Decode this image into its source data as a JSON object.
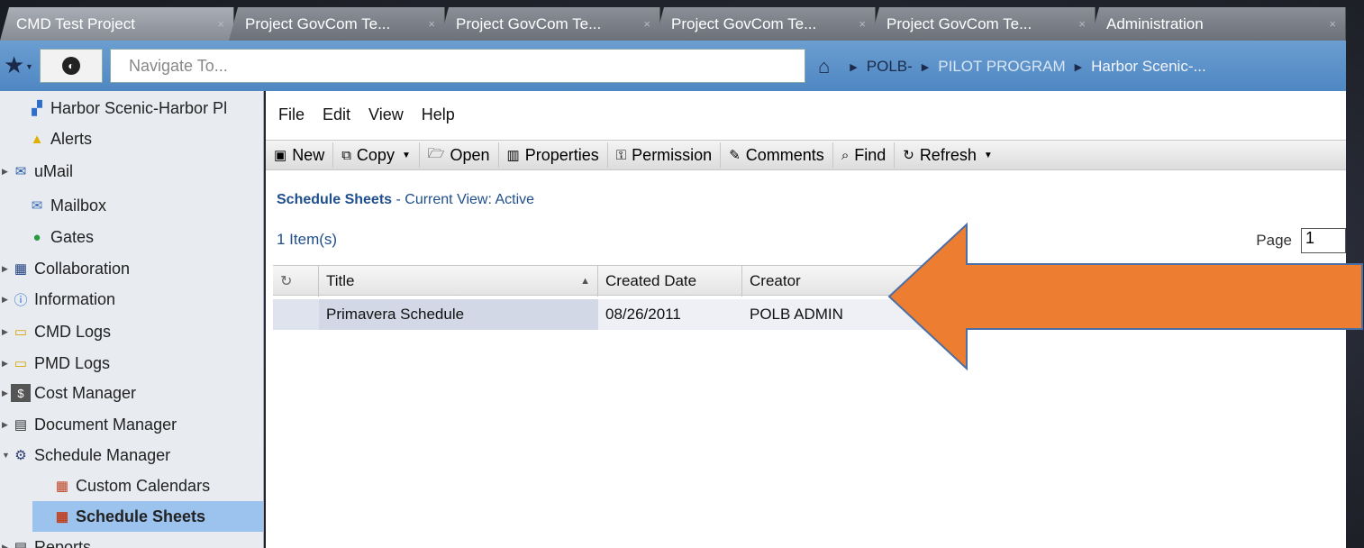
{
  "tabs": [
    {
      "label": "CMD Test Project",
      "close": "×"
    },
    {
      "label": "Project GovCom Te...",
      "close": "×"
    },
    {
      "label": "Project GovCom Te...",
      "close": "×"
    },
    {
      "label": "Project GovCom Te...",
      "close": "×"
    },
    {
      "label": "Project GovCom Te...",
      "close": "×"
    },
    {
      "label": "Administration",
      "close": "×"
    }
  ],
  "nav": {
    "placeholder": "Navigate To...",
    "breadcrumbs": [
      "POLB-",
      "PILOT PROGRAM",
      "Harbor Scenic-..."
    ]
  },
  "sidebar": {
    "items": [
      {
        "label": "Harbor Scenic-Harbor Pl",
        "icon": "project-icon"
      },
      {
        "label": "Alerts",
        "icon": "alert-icon"
      },
      {
        "label": "uMail",
        "icon": "umail-icon"
      },
      {
        "label": "Mailbox",
        "icon": "mailbox-icon"
      },
      {
        "label": "Gates",
        "icon": "gates-icon"
      },
      {
        "label": "Collaboration",
        "icon": "collaboration-icon"
      },
      {
        "label": "Information",
        "icon": "information-icon"
      },
      {
        "label": "CMD Logs",
        "icon": "folder-icon"
      },
      {
        "label": "PMD Logs",
        "icon": "folder-icon"
      },
      {
        "label": "Cost Manager",
        "icon": "cost-icon"
      },
      {
        "label": "Document Manager",
        "icon": "document-icon"
      },
      {
        "label": "Schedule Manager",
        "icon": "schedule-icon"
      },
      {
        "label": "Custom Calendars",
        "icon": "calendar-icon"
      },
      {
        "label": "Schedule Sheets",
        "icon": "calendar-icon"
      },
      {
        "label": "Reports",
        "icon": "reports-icon"
      }
    ]
  },
  "menu": [
    "File",
    "Edit",
    "View",
    "Help"
  ],
  "toolbar": {
    "new": "New",
    "copy": "Copy",
    "open": "Open",
    "properties": "Properties",
    "permission": "Permission",
    "comments": "Comments",
    "find": "Find",
    "refresh": "Refresh"
  },
  "content": {
    "title": "Schedule Sheets",
    "view": " - Current View:  Active",
    "count": "1  Item(s)",
    "page_label": "Page",
    "page_value": "1"
  },
  "grid": {
    "columns": [
      "Title",
      "Created Date",
      "Creator"
    ],
    "rows": [
      {
        "title": "Primavera Schedule",
        "created": "08/26/2011",
        "creator": "POLB ADMIN"
      }
    ]
  },
  "colors": {
    "accent": "#4f87c2",
    "arrow": "#ed7d31",
    "selected": "#9cc3ee"
  }
}
